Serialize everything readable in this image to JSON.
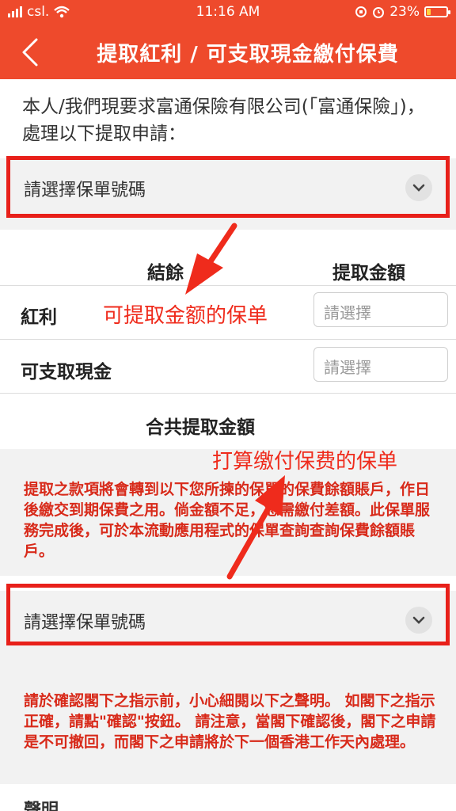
{
  "status_bar": {
    "carrier": "csl.",
    "time": "11:16 AM",
    "battery": "23%",
    "battery_level": 0.23
  },
  "nav": {
    "back_icon": "chevron-left-icon",
    "title": "提取紅利 / 可支取現金繳付保費"
  },
  "intro_text": "本人/我們現要求富通保險有限公司(「富通保險」)，處理以下提取申請：",
  "policy_select_1": {
    "placeholder": "請選擇保單號碼",
    "icon": "chevron-down-icon"
  },
  "table": {
    "col_balance": "結餘",
    "col_withdraw": "提取金額",
    "rows": [
      {
        "label": "紅利",
        "input_placeholder": "請選擇"
      },
      {
        "label": "可支取現金",
        "input_placeholder": "請選擇"
      }
    ],
    "total_label": "合共提取金額"
  },
  "transfer_note": "提取之款項將會轉到以下您所揀的保單的保費餘額賬戶，作日後繳交到期保費之用。倘金額不足，您需繳付差額。此保單服務完成後，可於本流動應用程式的保單查詢查詢保費餘額賬戶。",
  "policy_select_2": {
    "placeholder": "請選擇保單號碼",
    "icon": "chevron-down-icon"
  },
  "confirm_note": "請於確認閣下之指示前，小心細閱以下之聲明。 如閣下之指示正確，請點\"確認\"按鈕。 請注意，當閣下確認後，閣下之申請是不可撤回，而閣下之申請將於下一個香港工作天內處理。",
  "declaration_title": "聲明",
  "annotations": {
    "upper": "可提取金额的保单",
    "lower": "打算缴付保费的保单"
  },
  "colors": {
    "brand": "#ee4a2c",
    "annotation_red": "#ef2b1c",
    "note_red": "#d82a1a"
  }
}
